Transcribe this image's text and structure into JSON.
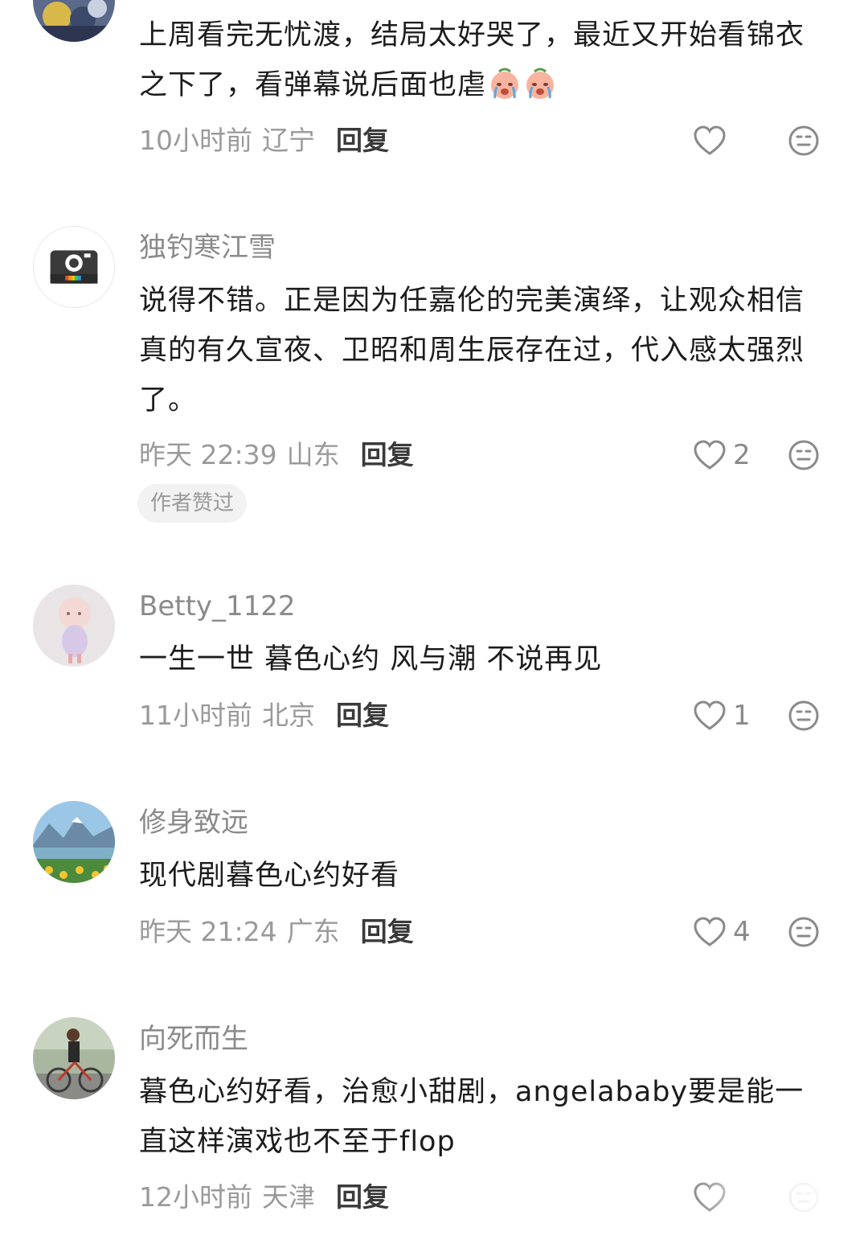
{
  "colors": {
    "username": "#8a8a8a",
    "body_text": "#1c1c1c",
    "meta": "#9a9a9a",
    "reply": "#3a3a3a",
    "badge_bg": "#f2f2f2"
  },
  "comments": [
    {
      "text_part1": "上周看完无忧渡，结局太好哭了，最近又开始看锦衣之下了，看弹幕说后面也虐",
      "emojis": [
        "crying-face-emoji",
        "crying-face-emoji"
      ],
      "time": "10小时前",
      "region": "辽宁",
      "reply_label": "回复",
      "like_count": ""
    },
    {
      "username": "独钓寒江雪",
      "text": "说得不错。正是因为任嘉伦的完美演绎，让观众相信真的有久宣夜、卫昭和周生辰存在过，代入感太强烈了。",
      "time": "昨天 22:39",
      "region": "山东",
      "reply_label": "回复",
      "like_count": "2",
      "badge": "作者赞过"
    },
    {
      "username": "Betty_1122",
      "text": "一生一世 暮色心约 风与潮 不说再见",
      "time": "11小时前",
      "region": "北京",
      "reply_label": "回复",
      "like_count": "1"
    },
    {
      "username": "修身致远",
      "text": "现代剧暮色心约好看",
      "time": "昨天 21:24",
      "region": "广东",
      "reply_label": "回复",
      "like_count": "4"
    },
    {
      "username": "向死而生",
      "text": "暮色心约好看，治愈小甜剧，angelababy要是能一直这样演戏也不至于flop",
      "time": "12小时前",
      "region": "天津",
      "reply_label": "回复",
      "like_count": ""
    }
  ],
  "icons": {
    "like": "heart-outline-icon",
    "dislike": "neutral-face-icon"
  }
}
